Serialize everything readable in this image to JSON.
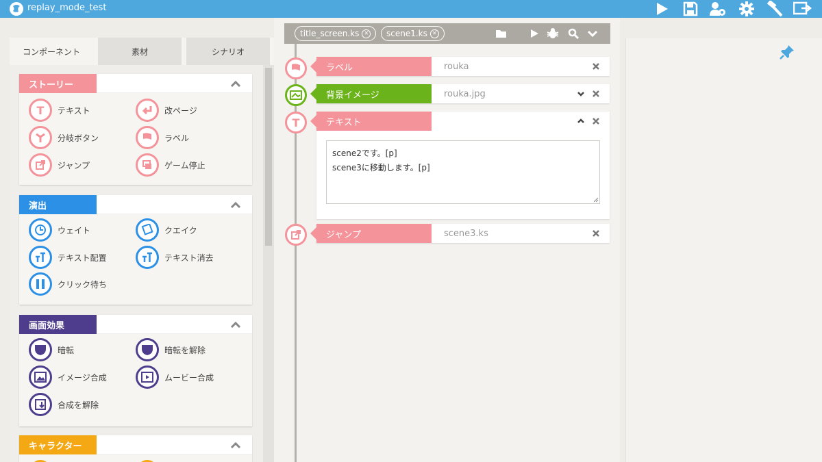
{
  "app": {
    "title": "replay_mode_test"
  },
  "toolbar": {
    "icons": [
      "play-icon",
      "save-icon",
      "user-settings-icon",
      "gear-icon",
      "hammer-icon",
      "export-icon"
    ]
  },
  "left_tabs": [
    {
      "label": "コンポーネント",
      "active": true
    },
    {
      "label": "素材",
      "active": false
    },
    {
      "label": "シナリオ",
      "active": false
    }
  ],
  "sections": {
    "story": {
      "title": "ストーリー",
      "color": "#f4939a",
      "items": [
        "テキスト",
        "改ページ",
        "分岐ボタン",
        "ラベル",
        "ジャンプ",
        "ゲーム停止"
      ]
    },
    "direction": {
      "title": "演出",
      "color": "#2b90e6",
      "items": [
        "ウェイト",
        "クエイク",
        "テキスト配置",
        "テキスト消去",
        "クリック待ち"
      ]
    },
    "screen": {
      "title": "画面効果",
      "color": "#4e3d8c",
      "items": [
        "暗転",
        "暗転を解除",
        "イメージ合成",
        "ムービー合成",
        "合成を解除"
      ]
    },
    "character": {
      "title": "キャラクター",
      "color": "#f4a813"
    }
  },
  "files": {
    "tabs": [
      "title_screen.ks",
      "scene1.ks"
    ],
    "icons": [
      "folder-icon",
      "play-icon",
      "bug-icon",
      "search-icon",
      "chevron-down-icon"
    ]
  },
  "commands": {
    "label": {
      "name": "ラベル",
      "value": "rouka",
      "color": "#f4939a"
    },
    "bg": {
      "name": "背景イメージ",
      "value": "rouka.jpg",
      "color": "#6bb31a"
    },
    "text": {
      "name": "テキスト",
      "value": "scene2です。[p]\nscene3に移動します。[p]",
      "color": "#f4939a"
    },
    "jump": {
      "name": "ジャンプ",
      "value": "scene3.ks",
      "color": "#f4939a"
    }
  }
}
